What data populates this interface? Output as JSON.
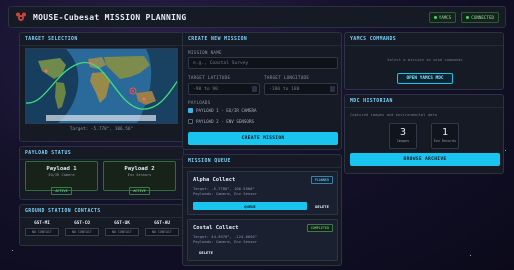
{
  "app": {
    "title": "MOUSE-Cubesat MISSION PLANNING"
  },
  "header": {
    "badges": [
      {
        "label": "YAMCS"
      },
      {
        "label": "CONNECTED"
      }
    ]
  },
  "target": {
    "title": "TARGET SELECTION",
    "readout": "Target: -5.778°, 106.56°"
  },
  "payload_status": {
    "title": "PAYLOAD STATUS",
    "cards": [
      {
        "name": "Payload 1",
        "sub": "EO/IR Camera",
        "state": "ACTIVE"
      },
      {
        "name": "Payload 2",
        "sub": "Env Sensors",
        "state": "ACTIVE"
      }
    ]
  },
  "ground": {
    "title": "GROUND STATION CONTACTS",
    "stations": [
      {
        "name": "GST-MI",
        "state": "NO CONTACT"
      },
      {
        "name": "GST-CO",
        "state": "NO CONTACT"
      },
      {
        "name": "GST-UK",
        "state": "NO CONTACT"
      },
      {
        "name": "GST-AU",
        "state": "NO CONTACT"
      }
    ]
  },
  "create": {
    "title": "CREATE NEW MISSION",
    "name_label": "MISSION NAME",
    "name_placeholder": "e.g., Coastal Survey",
    "lat_label": "TARGET LATITUDE",
    "lat_placeholder": "-90 to 90",
    "lon_label": "TARGET LONGITUDE",
    "lon_placeholder": "-180 to 180",
    "payloads_label": "PAYLOADS",
    "payload1": "PAYLOAD 1 - EO/IR CAMERA",
    "payload2": "PAYLOAD 2 - ENV SENSORS",
    "submit": "CREATE MISSION"
  },
  "queue": {
    "title": "MISSION QUEUE",
    "missions": [
      {
        "name": "Alpha Collect",
        "status": "PLANNED",
        "target": "Target: -5.7780°, 106.5560°",
        "payloads": "Payloads: Camera, Env Sensor",
        "primary": "QUEUE",
        "delete": "DELETE"
      },
      {
        "name": "Costal Collect",
        "status": "COMPLETED",
        "target": "Target: 44.5970°, -124.0650°",
        "payloads": "Payloads: Camera, Env Sensor",
        "delete": "DELETE"
      }
    ]
  },
  "yamcs": {
    "title": "YAMCS COMMANDS",
    "hint": "Select a mission to send commands",
    "button": "OPEN YAMCS MDC"
  },
  "mdc": {
    "title": "MDC HISTORIAN",
    "hint": "Captured images and environmental data",
    "stats": [
      {
        "value": "3",
        "label": "Images"
      },
      {
        "value": "1",
        "label": "Env Records"
      }
    ],
    "button": "BROWSE ARCHIVE"
  },
  "colors": {
    "accent": "#19c4ef",
    "ok": "#3ddc6a",
    "panel": "#151a24"
  }
}
